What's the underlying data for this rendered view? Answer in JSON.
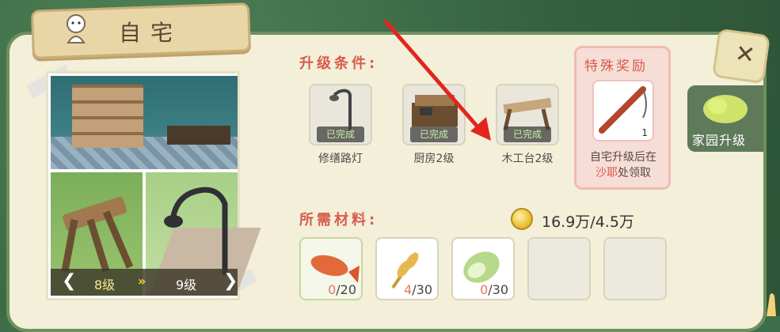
{
  "window": {
    "title": "自宅"
  },
  "preview": {
    "current_level": "8级",
    "next_level": "9级",
    "prev_icon": "chevron-left",
    "next_icon": "chevron-right",
    "mid_icon": "double-chevron-right"
  },
  "upgrade": {
    "title": "升级条件:",
    "conditions": [
      {
        "name": "修缮路灯",
        "status": "已完成",
        "icon": "street-lamp-icon"
      },
      {
        "name": "厨房2级",
        "status": "已完成",
        "icon": "kitchen-icon"
      },
      {
        "name": "木工台2级",
        "status": "已完成",
        "icon": "workbench-icon"
      }
    ]
  },
  "reward": {
    "title": "特殊奖励",
    "item_count": "1",
    "text_line1": "自宅升级后在",
    "text_hl": "沙耶",
    "text_line2": "处领取",
    "icon": "fishing-rod-icon"
  },
  "materials": {
    "title": "所需材料:",
    "coins": "16.9万/4.5万",
    "items": [
      {
        "have": "0",
        "need": "/20",
        "icon": "fish-icon"
      },
      {
        "have": "4",
        "need": "/30",
        "icon": "wheat-icon"
      },
      {
        "have": "0",
        "need": "/30",
        "icon": "cabbage-icon"
      },
      {
        "have": "",
        "need": "",
        "icon": ""
      },
      {
        "have": "",
        "need": "",
        "icon": ""
      }
    ]
  },
  "side_tab": {
    "label": "家园升级",
    "icon": "garden-upgrade-icon"
  },
  "colors": {
    "accent_red": "#d85b4b",
    "panel": "#f3efd9",
    "frame_green": "#6f8f5e",
    "reward_bg": "#f6ded7"
  }
}
